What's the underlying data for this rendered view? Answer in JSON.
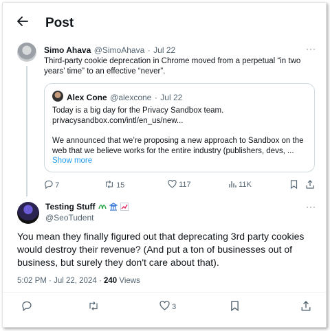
{
  "header": {
    "back_icon": "arrow-left-icon",
    "title": "Post"
  },
  "original_post": {
    "author_name": "Simo Ahava",
    "handle": "@SimoAhava",
    "separator": "·",
    "date": "Jul 22",
    "text": "Third-party cookie deprecation in Chrome moved from a perpetual “in two years’ time” to an effective “never”.",
    "quoted": {
      "author_name": "Alex Cone",
      "handle": "@alexcone",
      "separator": "·",
      "date": "Jul 22",
      "line1": "Today is a big day for the Privacy Sandbox team.",
      "line2": "privacysandbox.com/intl/en_us/new...",
      "line3": "We announced that we’re proposing a new approach to Sandbox on the",
      "line4": "web that we believe works for the entire industry (publishers, devs, ...",
      "show_more": "Show more"
    },
    "stats": {
      "replies": "7",
      "reposts": "15",
      "likes": "117",
      "views": "11K"
    }
  },
  "reply_post": {
    "author_name": "Testing Stuff",
    "handle": "@SeoTudent",
    "text": "You mean they finally figured out that deprecating 3rd party cookies would destroy their revenue? (And put a ton of businesses out of business, but surely they don't care about that).",
    "time": "5:02 PM",
    "separator": "·",
    "date": "Jul 22, 2024",
    "separator2": "·",
    "views_count": "240",
    "views_label": "Views",
    "stats": {
      "likes": "3"
    }
  },
  "colors": {
    "accent": "#1d9bf0",
    "muted": "#536471",
    "text": "#0f1419",
    "border": "#cfd9de"
  }
}
